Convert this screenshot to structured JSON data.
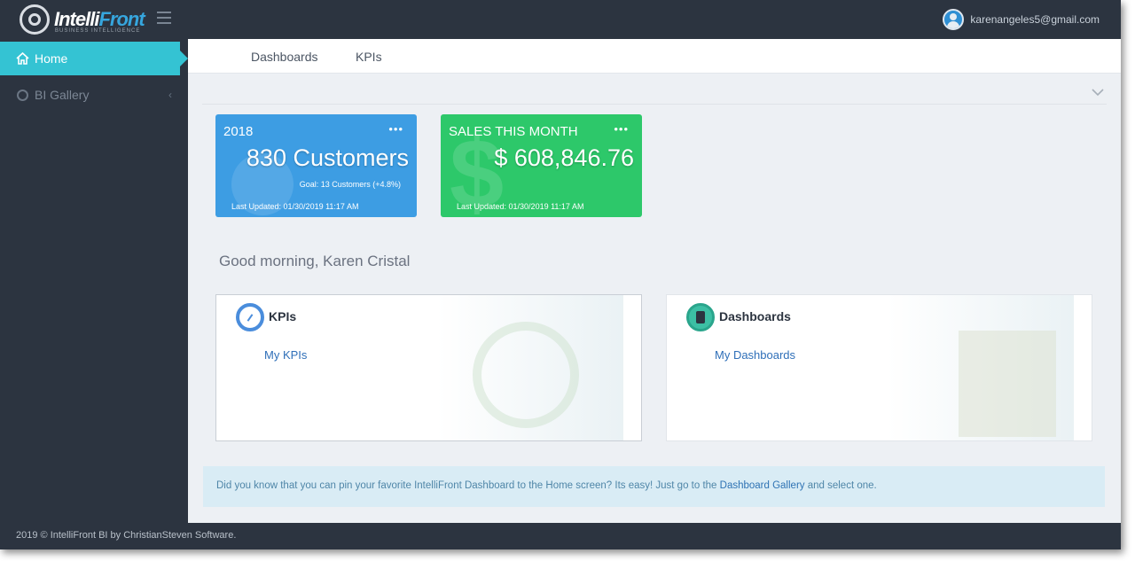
{
  "app": {
    "logo_text_1": "Intelli",
    "logo_text_2": "Front",
    "logo_sub": "BUSINESS INTELLIGENCE"
  },
  "header": {
    "user_email": "karenangeles5@gmail.com"
  },
  "sidebar": {
    "items": [
      {
        "label": "Home",
        "icon": "home-icon",
        "active": true
      },
      {
        "label": "BI Gallery",
        "icon": "globe-icon",
        "active": false
      }
    ]
  },
  "tabs": [
    "Dashboards",
    "KPIs"
  ],
  "tiles": [
    {
      "label": "2018",
      "value": "830 Customers",
      "goal": "Goal: 13 Customers (+4.8%)",
      "updated": "Last Updated: 01/30/2019 11:17 AM",
      "color": "#3d9de3"
    },
    {
      "label": "SALES THIS MONTH",
      "value": "$ 608,846.76",
      "updated": "Last Updated: 01/30/2019 11:17 AM",
      "color": "#2dc86a"
    }
  ],
  "tile_menu": "•••",
  "greeting": "Good morning, Karen Cristal",
  "cards": [
    {
      "title": "KPIs",
      "link": "My KPIs",
      "icon": "gauge-icon"
    },
    {
      "title": "Dashboards",
      "link": "My Dashboards",
      "icon": "tablet-icon"
    }
  ],
  "tip": {
    "before": "Did you know that you can pin your favorite IntelliFront Dashboard to the Home screen? Its easy! Just go to the ",
    "link": "Dashboard Gallery",
    "after": " and select one."
  },
  "footer": "2019 © IntelliFront BI by ChristianSteven Software.",
  "colors": {
    "sidebar_bg": "#2c3440",
    "active_item": "#34c3d3",
    "tile_blue": "#3d9de3",
    "tile_green": "#2dc86a",
    "main_bg": "#edf0f4"
  }
}
